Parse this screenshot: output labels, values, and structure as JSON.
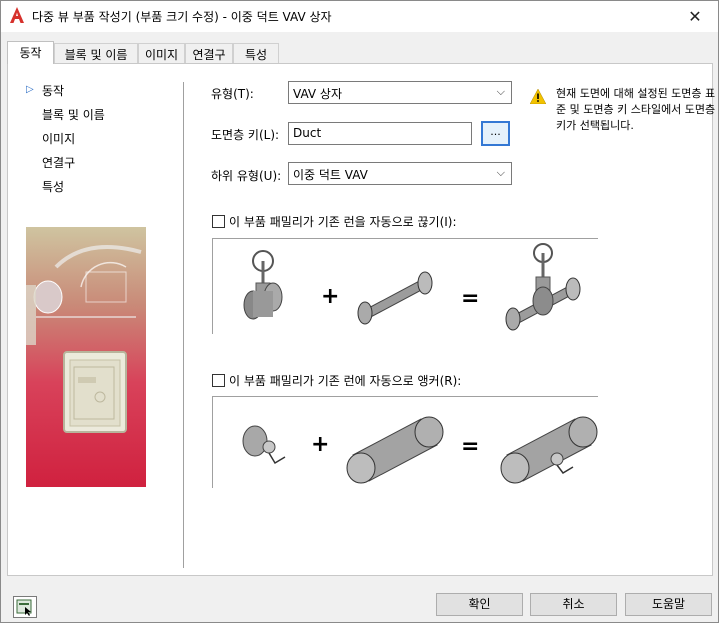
{
  "window": {
    "title": "다중 뷰 부품 작성기 (부품 크기 수정) - 이중 덕트 VAV 상자"
  },
  "tabs": [
    {
      "label": "동작"
    },
    {
      "label": "블록 및 이름"
    },
    {
      "label": "이미지"
    },
    {
      "label": "연결구"
    },
    {
      "label": "특성"
    }
  ],
  "nav": [
    {
      "label": "동작"
    },
    {
      "label": "블록 및 이름"
    },
    {
      "label": "이미지"
    },
    {
      "label": "연결구"
    },
    {
      "label": "특성"
    }
  ],
  "form": {
    "type_label": "유형(T):",
    "type_value": "VAV 상자",
    "layer_key_label": "도면층 키(L):",
    "layer_key_value": "Duct",
    "browse_label": "...",
    "subtype_label": "하위 유형(U):",
    "subtype_value": "이중 덕트 VAV"
  },
  "warning": {
    "text": "현재 도면에 대해 설정된 도면층 표준 및 도면층 키 스타일에서 도면층 키가 선택됩니다."
  },
  "options": {
    "break_label": "이 부품 패밀리가 기존 런을 자동으로 끊기(I):",
    "break_checked": false,
    "anchor_label": "이 부품 패밀리가 기존 런에 자동으로 앵커(R):",
    "anchor_checked": false,
    "plus_symbol": "+",
    "equals_symbol": "="
  },
  "buttons": {
    "ok": "확인",
    "cancel": "취소",
    "help": "도움말"
  },
  "colors": {
    "accent": "#3478d4",
    "nav_arrow": "#2b6cc4",
    "warning": "#f2c200"
  },
  "icons": {
    "close": "close-icon",
    "warning": "warning-icon",
    "app": "autocad-icon"
  }
}
